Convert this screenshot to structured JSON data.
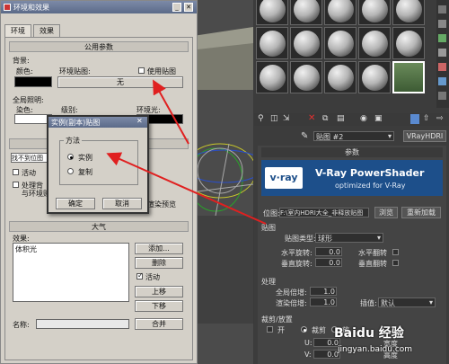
{
  "env_dialog": {
    "title": "环境和效果",
    "tabs": [
      "环境",
      "效果"
    ],
    "common_params": {
      "header": "公用参数",
      "background_label": "背景:",
      "color_label": "颜色:",
      "env_map_label": "环境贴图:",
      "use_map_label": "使用贴图",
      "env_map_value": "无",
      "global_lighting_label": "全局照明:",
      "tint_label": "染色:",
      "level_label": "级别:",
      "ambient_label": "环境光:"
    },
    "exposure": {
      "dropdown": "找不到位图",
      "active_label": "活动",
      "process_bg_1": "处理背",
      "process_bg_2": "与环境贴",
      "preview_label": "渲染预览"
    },
    "atmosphere": {
      "header": "大气",
      "effects_label": "效果:",
      "list_items": [
        "体积光"
      ],
      "add_button": "添加...",
      "delete_button": "删除",
      "active_label": "活动",
      "move_up_button": "上移",
      "move_down_button": "下移",
      "name_label": "名称:",
      "merge_button": "合并"
    }
  },
  "instance_dialog": {
    "title": "实例(副本)贴图",
    "group_label": "方法",
    "options": [
      "实例",
      "复制"
    ],
    "selected": "实例",
    "ok_button": "确定",
    "cancel_button": "取消"
  },
  "material_editor": {
    "map_name": "贴图 #2",
    "map_type": "VRayHDRI",
    "params_header": "参数",
    "banner_title": "V-Ray PowerShader",
    "banner_sub": "optimized for V-Ray",
    "banner_logo": "v·ray",
    "position_label": "位图:",
    "bitmap_path": "F:\\室内HDRI大全_非释放贴图",
    "browse_button": "浏览",
    "reload_button": "重新加载",
    "mapping_section": "贴图",
    "map_type_label": "贴图类型:",
    "map_type_value": "球形",
    "h_rotate_label": "水平旋转:",
    "h_rotate_value": "0.0",
    "h_flip_label": "水平翻转",
    "v_rotate_label": "垂直旋转:",
    "v_rotate_value": "0.0",
    "v_flip_label": "垂直翻转",
    "process_label": "处理",
    "overall_mult_label": "全局倍增:",
    "overall_mult_value": "1.0",
    "render_mult_label": "渲染倍增:",
    "render_mult_value": "1.0",
    "interp_label": "插值:",
    "interp_value": "默认",
    "crop_label": "裁剪/放置",
    "on_label": "开",
    "crop_option": "裁剪",
    "place_option": "放",
    "u_label": "U:",
    "v_label": "V:",
    "u_value": "0.0",
    "v_value": "0.0",
    "width_label": "宽度",
    "height_label": "高度"
  },
  "watermark": {
    "text": "Baidu 经验",
    "url": "jingyan.baidu.com"
  },
  "colors": {
    "arrow": "#e02020",
    "vray_banner": "#1d4f8a"
  }
}
